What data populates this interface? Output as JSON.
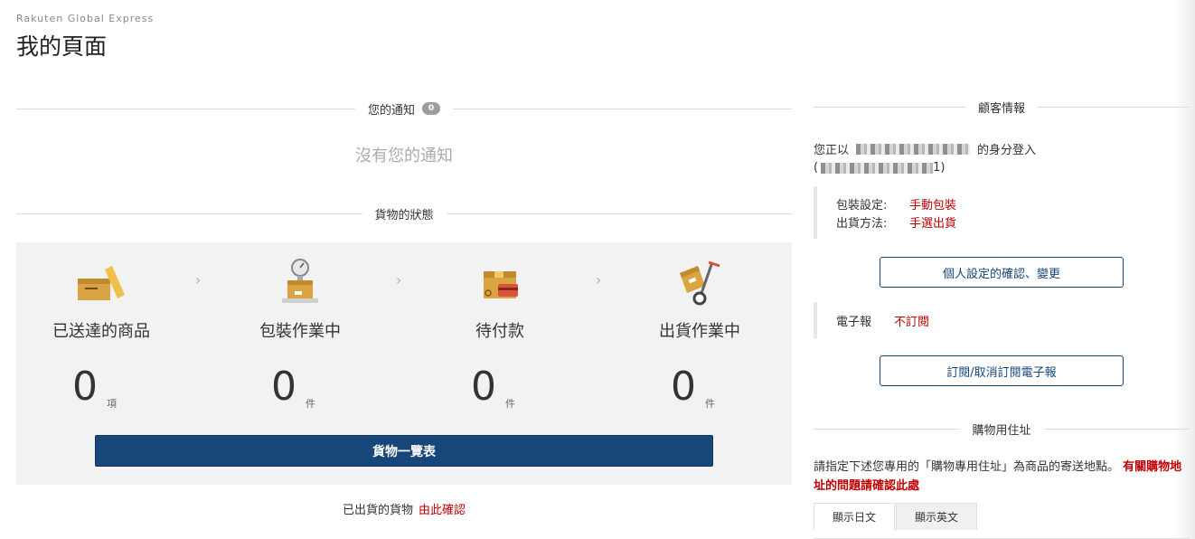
{
  "header": {
    "brand": "Rakuten Global Express",
    "title": "我的頁面"
  },
  "notifications": {
    "title": "您的通知",
    "count": "0",
    "empty_text": "沒有您的通知"
  },
  "shipment_status": {
    "title": "貨物的狀態",
    "steps": [
      {
        "label": "已送達的商品",
        "count": "0",
        "unit": "項",
        "icon": "box-delivered-icon"
      },
      {
        "label": "包裝作業中",
        "count": "0",
        "unit": "件",
        "icon": "scale-package-icon"
      },
      {
        "label": "待付款",
        "count": "0",
        "unit": "件",
        "icon": "package-payment-icon"
      },
      {
        "label": "出貨作業中",
        "count": "0",
        "unit": "件",
        "icon": "hand-truck-icon"
      }
    ],
    "chevron": "›",
    "list_button": "貨物一覽表",
    "shipped_text": "已出貨的貨物",
    "shipped_link": "由此確認"
  },
  "customer": {
    "title": "顧客情報",
    "login_prefix": "您正以",
    "login_suffix": "的身分登入",
    "login_paren_open": "(",
    "login_paren_close": "1)",
    "packing_label": "包裝設定:",
    "packing_value": "手動包裝",
    "shipping_label": "出貨方法:",
    "shipping_value": "手選出貨",
    "settings_button": "個人設定的確認、變更",
    "newsletter_label": "電子報",
    "newsletter_value": "不訂閱",
    "newsletter_button": "訂閱/取消訂閱電子報"
  },
  "shopping_address": {
    "title": "購物用住址",
    "description": "請指定下述您專用的「購物專用住址」為商品的寄送地點。",
    "help_link": "有關購物地址的問題請確認此處",
    "tabs": [
      "顯示日文",
      "顯示英文"
    ]
  },
  "colors": {
    "primary": "#17467a",
    "accent_red": "#bf0000",
    "panel_bg": "#f2f2f2"
  }
}
